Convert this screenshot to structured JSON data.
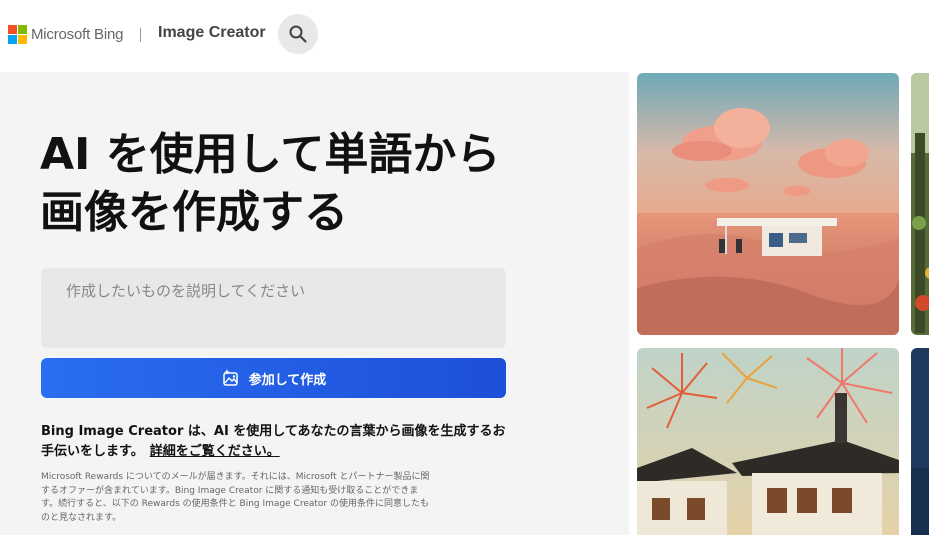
{
  "header": {
    "brand": "Microsoft Bing",
    "product_name": "Image Creator",
    "search_icon": "search-icon"
  },
  "hero": {
    "title": "AI を使用して単語から画像を作成する"
  },
  "prompt": {
    "placeholder": "作成したいものを説明してください"
  },
  "create_button": {
    "label": "参加して作成",
    "icon": "image-sparkle-icon"
  },
  "description": {
    "text": "Bing Image Creator は、AI を使用してあなたの言葉から画像を生成するお手伝いをします。",
    "link": "詳細をご覧ください。"
  },
  "fine_print": "Microsoft Rewards についてのメールが届きます。それには、Microsoft とパートナー製品に関するオファーが含まれています。Bing Image Creator に関する通知も受け取ることができます。続行すると、以下の Rewards の使用条件と Bing Image Creator の使用条件に同意したものと見なされます。",
  "gallery": {
    "images": [
      "desert-gas-station-image",
      "fireworks-pagoda-image",
      "forest-image",
      "night-image"
    ]
  },
  "colors": {
    "accent": "#1d4fd8",
    "logo_red": "#f25022",
    "logo_green": "#7fba00",
    "logo_blue": "#00a4ef",
    "logo_yellow": "#ffb900"
  }
}
